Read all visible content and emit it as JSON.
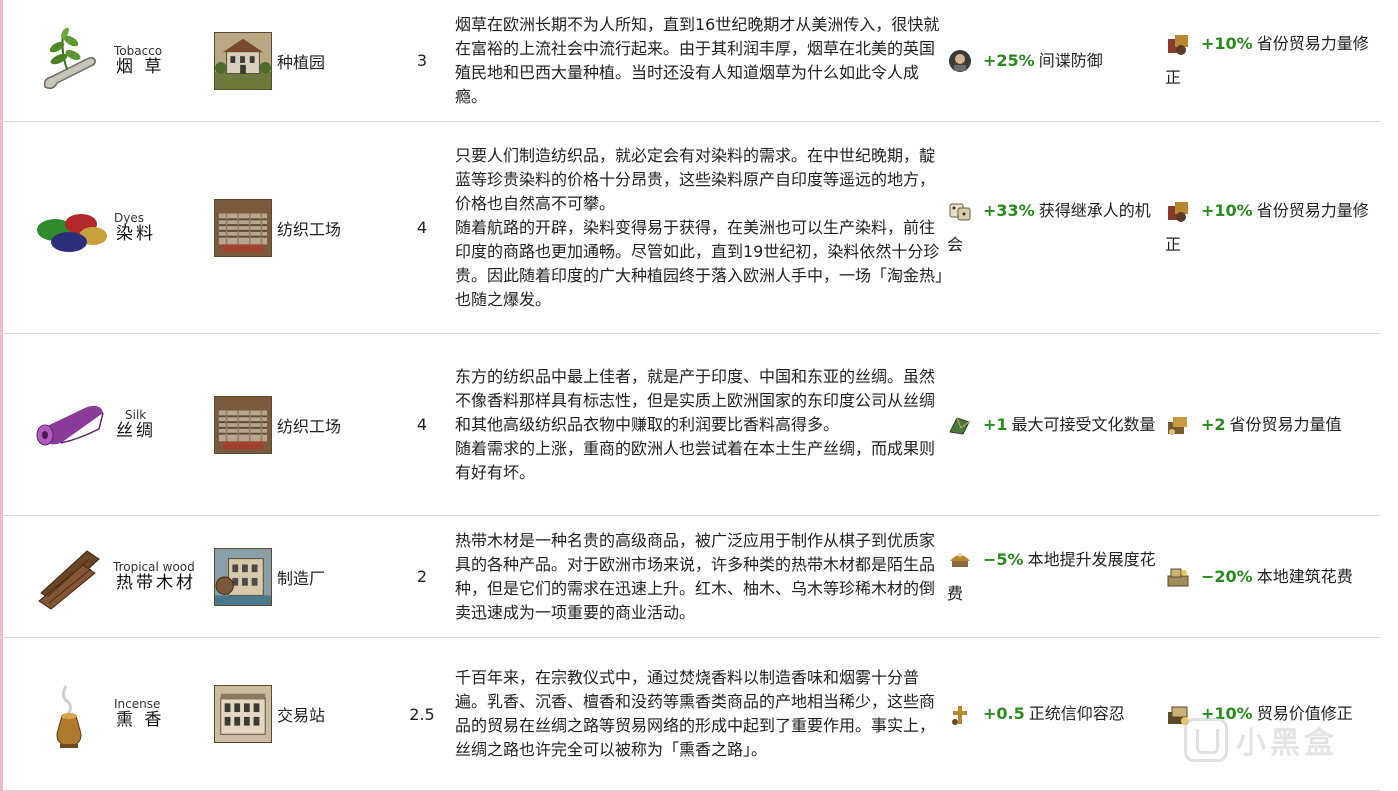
{
  "rows": [
    {
      "icon": "tobacco-icon",
      "name_en": "Tobacco",
      "name_zh": "烟 草",
      "building_icon": "plantation-icon",
      "building": "种植园",
      "number": "3",
      "desc": [
        "烟草在欧洲长期不为人所知，直到16世纪晚期才从美洲传入，很快就在富裕的上流社会中流行起来。由于其利润丰厚，烟草在北美的英国殖民地和巴西大量种植。当时还没有人知道烟草为什么如此令人成瘾。"
      ],
      "mod1": {
        "icon": "spy-defense-icon",
        "value": "+25%",
        "text": "间谍防御"
      },
      "mod2": {
        "icon": "trade-power-icon",
        "value": "+10%",
        "text": "省份贸易力量修正"
      }
    },
    {
      "icon": "dyes-icon",
      "name_en": "Dyes",
      "name_zh": "染料",
      "building_icon": "textile-factory-icon",
      "building": "纺织工场",
      "number": "4",
      "desc": [
        "只要人们制造纺织品，就必定会有对染料的需求。在中世纪晚期，靛蓝等珍贵染料的价格十分昂贵，这些染料原产自印度等遥远的地方，价格也自然高不可攀。",
        "随着航路的开辟，染料变得易于获得，在美洲也可以生产染料，前往印度的商路也更加通畅。尽管如此，直到19世纪初，染料依然十分珍贵。因此随着印度的广大种植园终于落入欧洲人手中，一场「淘金热」也随之爆发。"
      ],
      "mod1": {
        "icon": "heir-chance-icon",
        "value": "+33%",
        "text": "获得继承人的机会"
      },
      "mod2": {
        "icon": "trade-power-icon",
        "value": "+10%",
        "text": "省份贸易力量修正"
      }
    },
    {
      "icon": "silk-icon",
      "name_en": "Silk",
      "name_zh": "丝绸",
      "building_icon": "textile-factory-icon",
      "building": "纺织工场",
      "number": "4",
      "desc": [
        "东方的纺织品中最上佳者，就是产于印度、中国和东亚的丝绸。虽然不像香料那样具有标志性，但是实质上欧洲国家的东印度公司从丝绸和其他高级纺织品衣物中赚取的利润要比香料高得多。",
        "随着需求的上涨，重商的欧洲人也尝试着在本土生产丝绸，而成果则有好有坏。"
      ],
      "mod1": {
        "icon": "accepted-culture-icon",
        "value": "+1",
        "text": "最大可接受文化数量"
      },
      "mod2": {
        "icon": "trade-power-value-icon",
        "value": "+2",
        "text": "省份贸易力量值"
      }
    },
    {
      "icon": "tropical-wood-icon",
      "name_en": "Tropical wood",
      "name_zh": "热带木材",
      "building_icon": "manufactory-icon",
      "building": "制造厂",
      "number": "2",
      "desc": [
        "热带木材是一种名贵的高级商品，被广泛应用于制作从棋子到优质家具的各种产品。对于欧洲市场来说，许多种类的热带木材都是陌生品种，但是它们的需求在迅速上升。红木、柚木、乌木等珍稀木材的倒卖迅速成为一项重要的商业活动。"
      ],
      "mod1": {
        "icon": "development-cost-icon",
        "value": "−5%",
        "text": "本地提升发展度花费"
      },
      "mod2": {
        "icon": "construction-cost-icon",
        "value": "−20%",
        "text": "本地建筑花费"
      }
    },
    {
      "icon": "incense-icon",
      "name_en": "Incense",
      "name_zh": "熏 香",
      "building_icon": "trade-station-icon",
      "building": "交易站",
      "number": "2.5",
      "desc": [
        "千百年来，在宗教仪式中，通过焚烧香料以制造香味和烟雾十分普遍。乳香、沉香、檀香和没药等熏香类商品的产地相当稀少，这些商品的贸易在丝绸之路等贸易网络的形成中起到了重要作用。事实上，丝绸之路也许完全可以被称为「熏香之路」。"
      ],
      "mod1": {
        "icon": "tolerance-icon",
        "value": "+0.5",
        "text": "正统信仰容忍"
      },
      "mod2": {
        "icon": "trade-value-icon",
        "value": "+10%",
        "text": "贸易价值修正"
      }
    }
  ],
  "watermark": {
    "text": "小黑盒",
    "icon": "heybox-logo-icon"
  }
}
